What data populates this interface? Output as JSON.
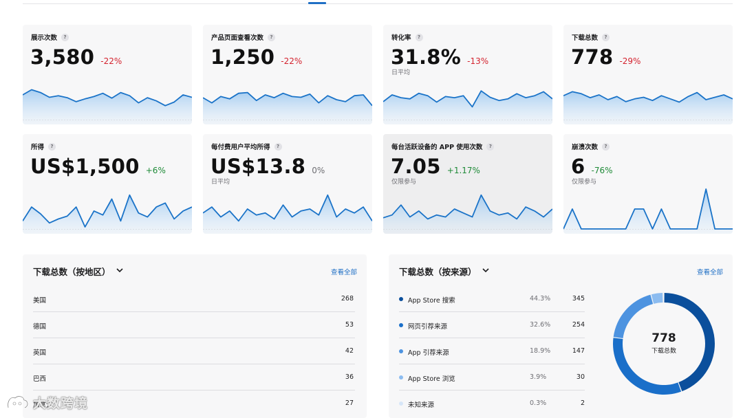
{
  "metric_cards": [
    {
      "title": "展示次数",
      "value": "3,580",
      "change": "-22%",
      "trend": "neg",
      "subtitle": "",
      "series": [
        0.62,
        0.75,
        0.68,
        0.56,
        0.6,
        0.55,
        0.45,
        0.52,
        0.58,
        0.66,
        0.54,
        0.68,
        0.6,
        0.42,
        0.55,
        0.47,
        0.35,
        0.44,
        0.62,
        0.56
      ]
    },
    {
      "title": "产品页面查看次数",
      "value": "1,250",
      "change": "-22%",
      "trend": "neg",
      "subtitle": "",
      "series": [
        0.55,
        0.42,
        0.58,
        0.52,
        0.66,
        0.68,
        0.48,
        0.62,
        0.55,
        0.66,
        0.58,
        0.56,
        0.64,
        0.42,
        0.6,
        0.5,
        0.45,
        0.6,
        0.62,
        0.35
      ]
    },
    {
      "title": "转化率",
      "value": "31.8%",
      "change": "-13%",
      "trend": "neg",
      "subtitle": "日平均",
      "series": [
        0.45,
        0.62,
        0.55,
        0.52,
        0.66,
        0.6,
        0.44,
        0.58,
        0.55,
        0.6,
        0.32,
        0.72,
        0.56,
        0.48,
        0.52,
        0.65,
        0.55,
        0.6,
        0.7,
        0.52
      ]
    },
    {
      "title": "下载总数",
      "value": "778",
      "change": "-29%",
      "trend": "neg",
      "subtitle": "",
      "series": [
        0.6,
        0.7,
        0.65,
        0.55,
        0.62,
        0.5,
        0.58,
        0.45,
        0.52,
        0.56,
        0.48,
        0.6,
        0.52,
        0.44,
        0.58,
        0.68,
        0.5,
        0.56,
        0.62,
        0.52
      ]
    },
    {
      "title": "所得",
      "value": "US$1,500",
      "change": "+6%",
      "trend": "pos",
      "subtitle": "",
      "series": [
        0.2,
        0.55,
        0.38,
        0.15,
        0.25,
        0.32,
        0.55,
        0.05,
        0.45,
        0.35,
        0.75,
        0.2,
        0.85,
        0.4,
        0.3,
        0.55,
        0.65,
        0.25,
        0.45,
        0.55
      ]
    },
    {
      "title": "每付费用户平均所得",
      "value": "US$13.8",
      "change": "0%",
      "trend": "neu",
      "subtitle": "日平均",
      "series": [
        0.4,
        0.55,
        0.3,
        0.45,
        0.2,
        0.5,
        0.35,
        0.4,
        0.25,
        0.6,
        0.3,
        0.45,
        0.5,
        0.35,
        0.85,
        0.3,
        0.5,
        0.4,
        0.55,
        0.2
      ]
    },
    {
      "title": "每台活跃设备的 APP 使用次数",
      "value": "7.05",
      "change": "+1.17%",
      "trend": "pos",
      "subtitle": "仅限参与",
      "series": [
        0.28,
        0.35,
        0.6,
        0.3,
        0.45,
        0.25,
        0.35,
        0.3,
        0.5,
        0.4,
        0.3,
        0.85,
        0.45,
        0.35,
        0.4,
        0.25,
        0.55,
        0.45,
        0.3,
        0.5
      ]
    },
    {
      "title": "崩溃次数",
      "value": "6",
      "change": "-76%",
      "trend": "pos",
      "subtitle": "仅限参与",
      "series": [
        0,
        0.5,
        0,
        0,
        0,
        0,
        0,
        0,
        0.5,
        0.5,
        0,
        0.5,
        0,
        0,
        0,
        0,
        1.0,
        0,
        0,
        0
      ]
    }
  ],
  "regions_panel": {
    "title": "下载总数（按地区）",
    "view_all": "查看全部",
    "rows": [
      {
        "name": "美国",
        "value": "268"
      },
      {
        "name": "德国",
        "value": "53"
      },
      {
        "name": "英国",
        "value": "42"
      },
      {
        "name": "巴西",
        "value": "36"
      },
      {
        "name": "加拿大",
        "value": "27"
      }
    ]
  },
  "sources_panel": {
    "title": "下载总数（按来源）",
    "view_all": "查看全部",
    "rows": [
      {
        "name": "App Store 搜索",
        "percent": "44.3%",
        "value": "345",
        "color": "#0b4f9c"
      },
      {
        "name": "网页引荐来源",
        "percent": "32.6%",
        "value": "254",
        "color": "#1a6fc9"
      },
      {
        "name": "App 引荐来源",
        "percent": "18.9%",
        "value": "147",
        "color": "#4d93e0"
      },
      {
        "name": "App Store 浏览",
        "percent": "3.9%",
        "value": "30",
        "color": "#8cbcf0"
      },
      {
        "name": "未知来源",
        "percent": "0.3%",
        "value": "2",
        "color": "#d7e6f8"
      }
    ],
    "donut_total": "778",
    "donut_label": "下载总数"
  },
  "watermark": "大数跨境"
}
